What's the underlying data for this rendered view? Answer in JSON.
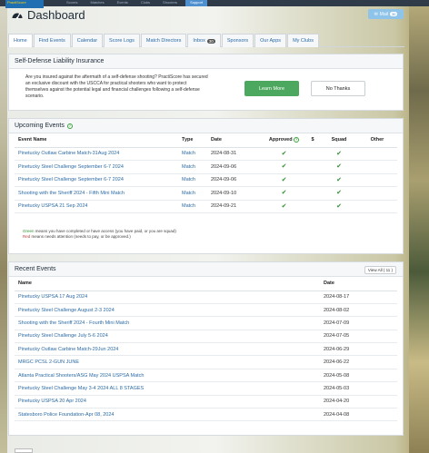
{
  "topbar": {
    "logo_text": "PractiScore",
    "logo_sub": "SCORE",
    "nav": [
      "Scores",
      "Matches",
      "Events",
      "Clubs",
      "Shooters",
      "Support"
    ],
    "active_nav": "Support"
  },
  "header": {
    "title": "Dashboard",
    "mail_label": "Mail",
    "mail_count": "30"
  },
  "tabs": [
    {
      "label": "Home"
    },
    {
      "label": "Find Events"
    },
    {
      "label": "Calendar"
    },
    {
      "label": "Score Logs"
    },
    {
      "label": "Match Directors"
    },
    {
      "label": "Inbox",
      "count": "30"
    },
    {
      "label": "Sponsors"
    },
    {
      "label": "Our Apps"
    },
    {
      "label": "My Clubs"
    }
  ],
  "insurance": {
    "title": "Self-Defense Liability Insurance",
    "text": "Are you insured against the aftermath of a self-defense shooting? PractiScore has secured an exclusive discount with the USCCA for practical shooters who want to protect themselves against the potential legal and financial challenges following a self-defense scenario.",
    "learn_more": "Learn More",
    "no_thanks": "No Thanks"
  },
  "upcoming": {
    "title": "Upcoming Events",
    "columns": {
      "event": "Event Name",
      "type": "Type",
      "date": "Date",
      "approved": "Approved",
      "fee": "$",
      "squad": "Squad",
      "other": "Other"
    },
    "rows": [
      {
        "name": "Pinetucky Outlaw Carbine Match-31Aug 2024",
        "type": "Match",
        "date": "2024-08-31"
      },
      {
        "name": "Pinetucky Steel Challenge September 6-7 2024",
        "type": "Match",
        "date": "2024-09-06"
      },
      {
        "name": "Pinetucky Steel Challenge September 6-7 2024",
        "type": "Match",
        "date": "2024-09-06"
      },
      {
        "name": "Shooting with the Sheriff 2024 - Fifth Mini Match",
        "type": "Match",
        "date": "2024-09-10"
      },
      {
        "name": "Pinetucky USPSA 21 Sep 2024",
        "type": "Match",
        "date": "2024-09-21"
      }
    ],
    "legend_green_word": "Green",
    "legend_green": " means you have completed or have access (you have paid, or you are squad)",
    "legend_red_word": "Red",
    "legend_red": " means needs attention (needs to pay, or be approved.)"
  },
  "recent": {
    "title": "Recent Events",
    "view_all": "View All ( 11 )",
    "columns": {
      "name": "Name",
      "date": "Date"
    },
    "rows": [
      {
        "name": "Pinetucky USPSA 17 Aug 2024",
        "date": "2024-08-17"
      },
      {
        "name": "Pinetucky Steel Challenge August 2-3 2024",
        "date": "2024-08-02"
      },
      {
        "name": "Shooting with the Sheriff 2024 - Fourth Mini Match",
        "date": "2024-07-09"
      },
      {
        "name": "Pinetucky Steel Challenge July 5-6 2024",
        "date": "2024-07-05"
      },
      {
        "name": "Pinetucky Outlaw Carbine Match-29Jun 2024",
        "date": "2024-06-29"
      },
      {
        "name": "MRGC PCSL 2-GUN JUNE",
        "date": "2024-06-22"
      },
      {
        "name": "Atlanta Practical Shooters/ASG May 2024 USPSA Match",
        "date": "2024-05-08"
      },
      {
        "name": "Pinetucky Steel Challenge May 3-4 2024 ALL 8 STAGES",
        "date": "2024-05-03"
      },
      {
        "name": "Pinetucky USPSA 20 Apr 2024",
        "date": "2024-04-20"
      },
      {
        "name": "Statesboro Police Foundation-Apr 08, 2024",
        "date": "2024-04-08"
      }
    ]
  },
  "colors": {
    "accent": "#2c6ba5",
    "success": "#4ca85e",
    "check": "#2f8f2f"
  }
}
